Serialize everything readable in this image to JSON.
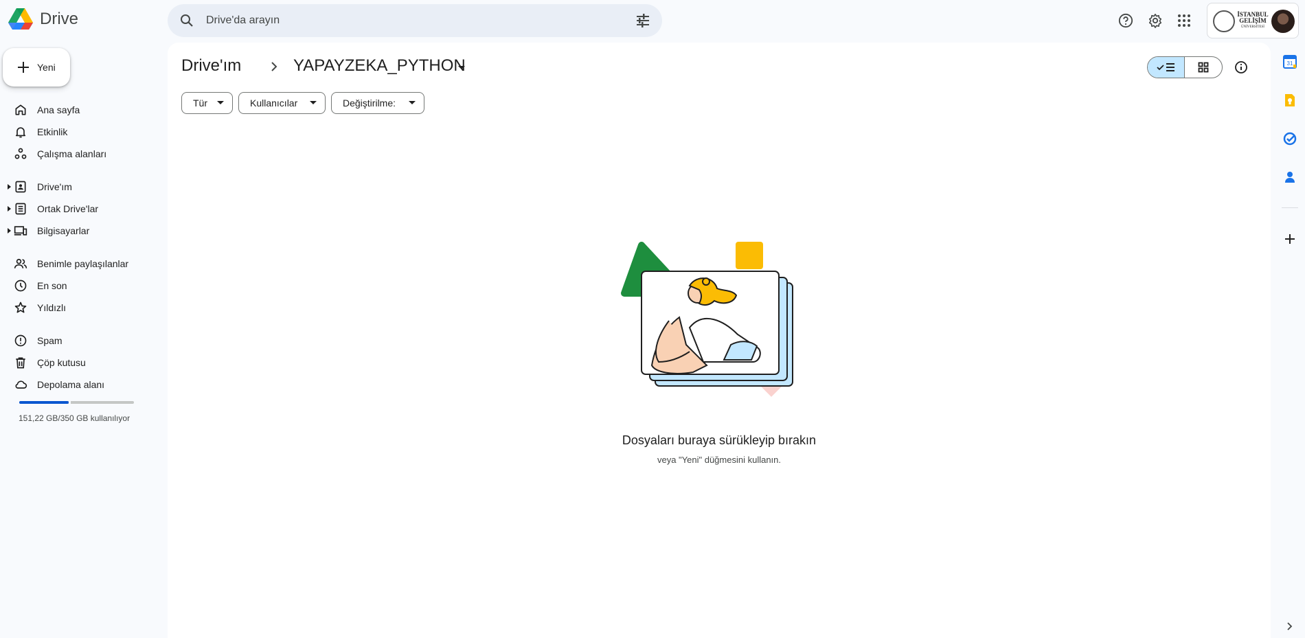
{
  "app": {
    "name": "Drive"
  },
  "search": {
    "placeholder": "Drive'da arayın"
  },
  "top_icons": [
    "help-icon",
    "settings-icon",
    "apps-icon"
  ],
  "account": {
    "org_line1": "İSTANBUL",
    "org_line2": "GELİŞİM",
    "org_line3": "ÜNİVERSİTESİ"
  },
  "new_button": {
    "label": "Yeni"
  },
  "sidebar": {
    "items": [
      {
        "label": "Ana sayfa",
        "icon": "home-icon"
      },
      {
        "label": "Etkinlik",
        "icon": "bell-icon"
      },
      {
        "label": "Çalışma alanları",
        "icon": "workspaces-icon"
      },
      {
        "label": "Drive'ım",
        "icon": "my-drive-icon",
        "expandable": true
      },
      {
        "label": "Ortak Drive'lar",
        "icon": "shared-drives-icon",
        "expandable": true
      },
      {
        "label": "Bilgisayarlar",
        "icon": "computers-icon",
        "expandable": true
      },
      {
        "label": "Benimle paylaşılanlar",
        "icon": "people-icon"
      },
      {
        "label": "En son",
        "icon": "clock-icon"
      },
      {
        "label": "Yıldızlı",
        "icon": "star-icon"
      },
      {
        "label": "Spam",
        "icon": "spam-icon"
      },
      {
        "label": "Çöp kutusu",
        "icon": "trash-icon"
      },
      {
        "label": "Depolama alanı",
        "icon": "cloud-icon"
      }
    ],
    "storage": {
      "text": "151,22 GB/350 GB kullanılıyor",
      "used_fraction": 0.432
    }
  },
  "breadcrumb": {
    "root": "Drive'ım",
    "current": "YAPAYZEKA_PYTHON"
  },
  "filters": [
    {
      "label": "Tür"
    },
    {
      "label": "Kullanıcılar"
    },
    {
      "label": "Değiştirilme:"
    }
  ],
  "empty_state": {
    "title": "Dosyaları buraya sürükleyip bırakın",
    "subtitle": "veya \"Yeni\" düğmesini kullanın."
  },
  "side_panel": {
    "apps": [
      "calendar-icon",
      "keep-icon",
      "tasks-icon",
      "contacts-icon"
    ],
    "calendar_day": "31"
  },
  "colors": {
    "accent": "#0b57d0",
    "selected": "#c2e7ff",
    "background": "#f8fafd"
  }
}
